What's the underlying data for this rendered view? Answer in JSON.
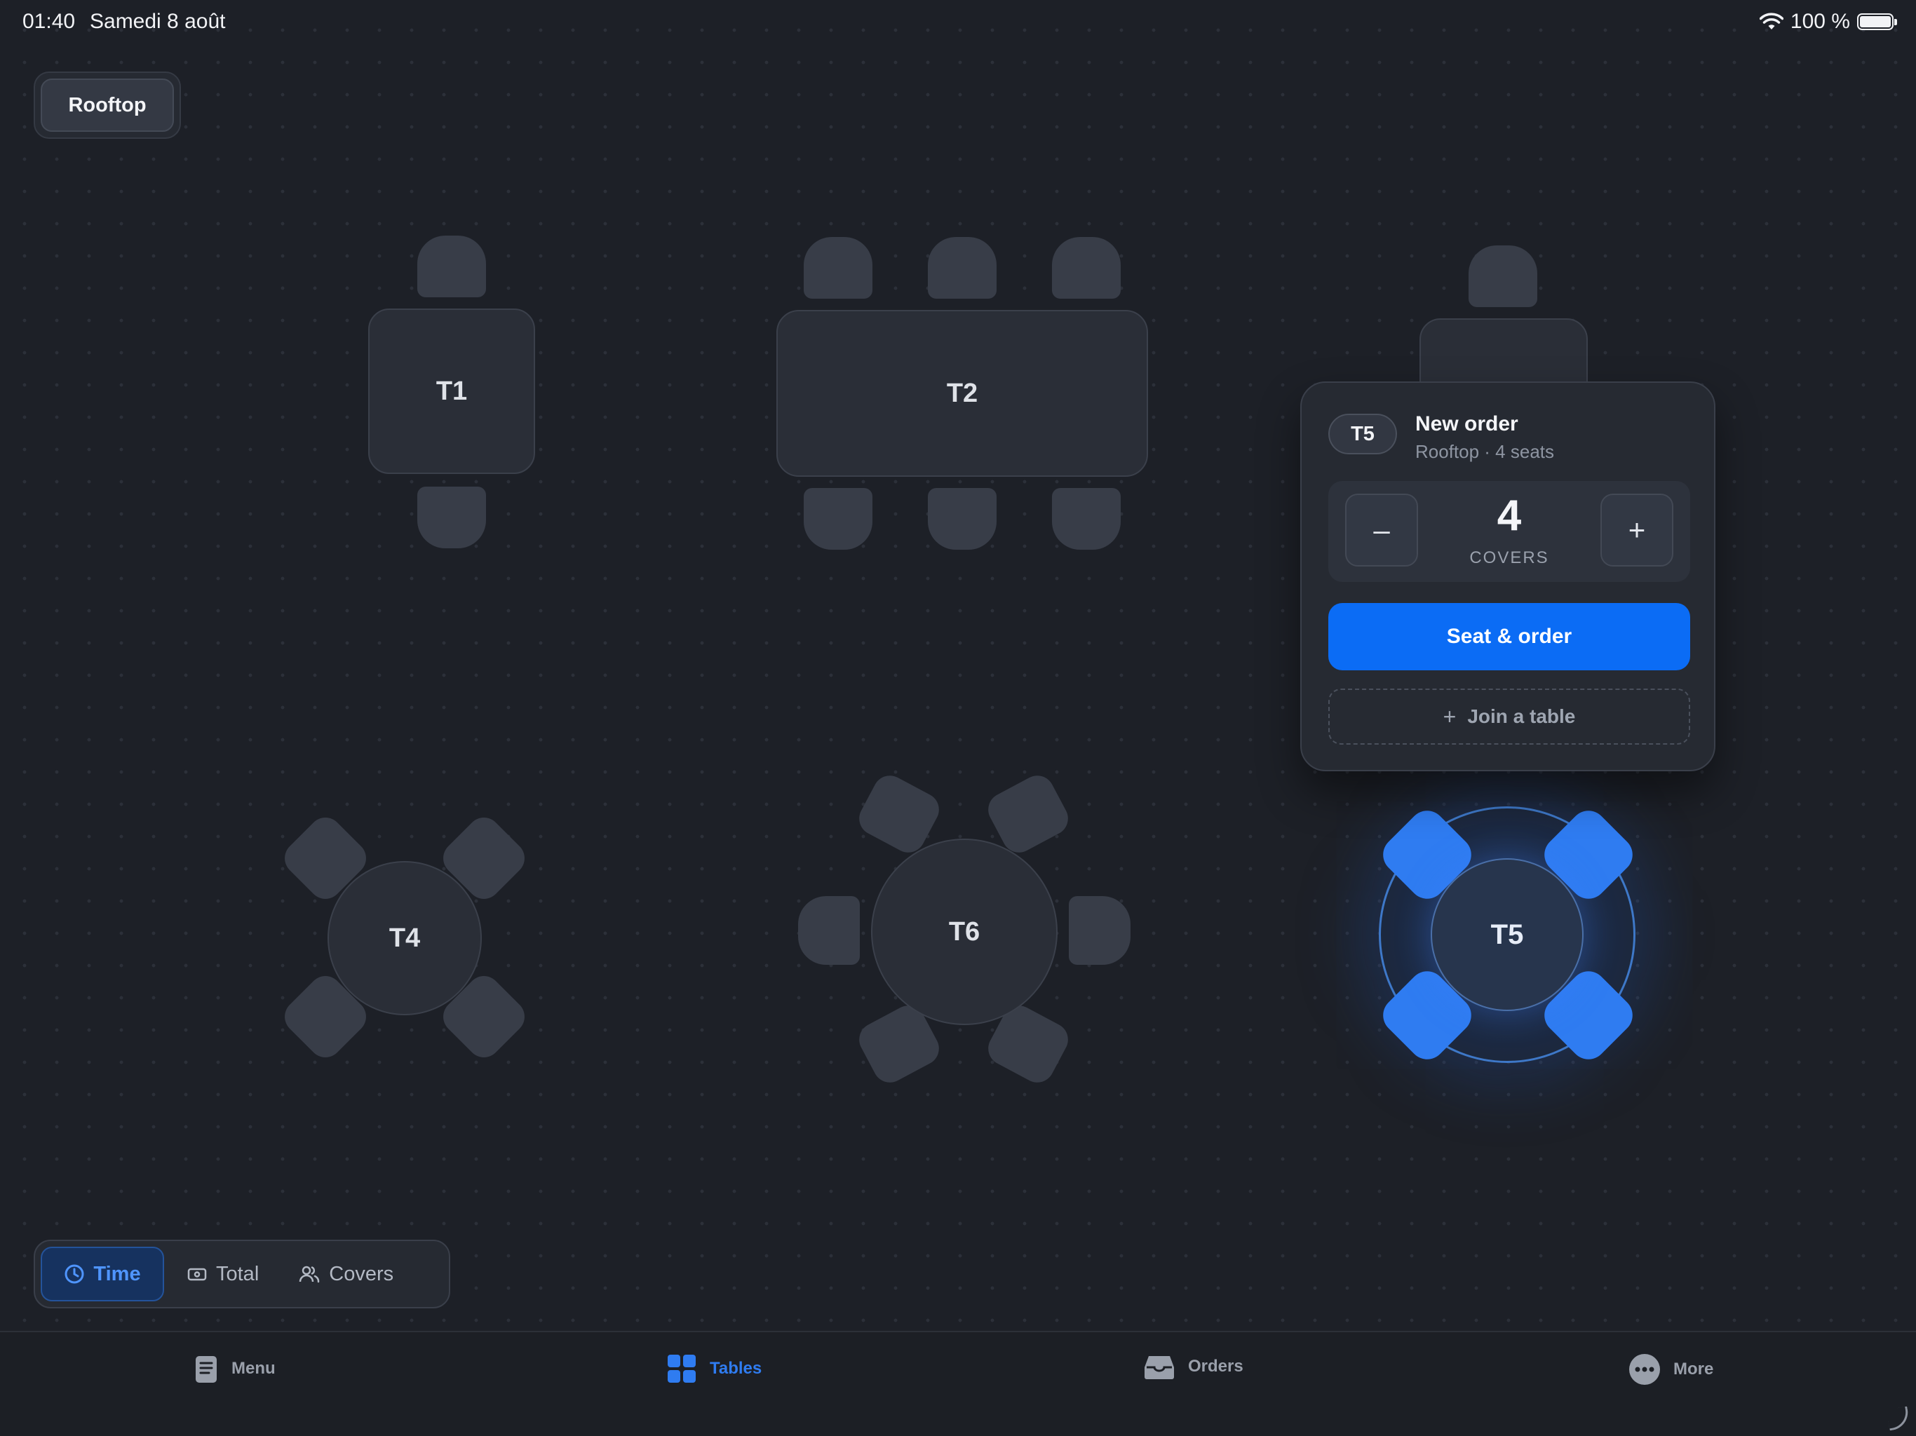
{
  "status_bar": {
    "time": "01:40",
    "date": "Samedi 8 août",
    "battery": "100 %",
    "icons": [
      "wifi-icon",
      "battery-icon"
    ]
  },
  "area": {
    "label": "Rooftop"
  },
  "tables": {
    "t1": {
      "label": "T1",
      "shape": "square",
      "seats": 2
    },
    "t2": {
      "label": "T2",
      "shape": "rectangle",
      "seats": 6
    },
    "t3": {
      "shape": "square",
      "seats": 2
    },
    "t4": {
      "label": "T4",
      "shape": "round",
      "seats": 4
    },
    "t6": {
      "label": "T6",
      "shape": "round",
      "seats": 6
    },
    "t5": {
      "label": "T5",
      "shape": "round",
      "seats": 4,
      "selected": true
    }
  },
  "popover": {
    "badge": "T5",
    "title": "New order",
    "subtitle": "Rooftop · 4 seats",
    "covers_value": "4",
    "covers_label": "COVERS",
    "minus": "–",
    "plus": "+",
    "primary": "Seat & order",
    "secondary": "Join a table",
    "secondary_icon": "+"
  },
  "metric_toggle": {
    "options": [
      {
        "label": "Time",
        "icon": "clock-icon",
        "active": true
      },
      {
        "label": "Total",
        "icon": "cash-icon",
        "active": false
      },
      {
        "label": "Covers",
        "icon": "people-icon",
        "active": false
      }
    ]
  },
  "tabbar": {
    "items": [
      {
        "label": "Menu",
        "icon": "menu-book-icon",
        "active": false
      },
      {
        "label": "Tables",
        "icon": "grid-icon",
        "active": true
      },
      {
        "label": "Orders",
        "icon": "tray-icon",
        "active": false
      },
      {
        "label": "More",
        "icon": "ellipsis-icon",
        "active": false
      }
    ]
  },
  "colors": {
    "background": "#1d2027",
    "accent": "#0b6cf5",
    "selected_seat": "#2f7cf1"
  }
}
